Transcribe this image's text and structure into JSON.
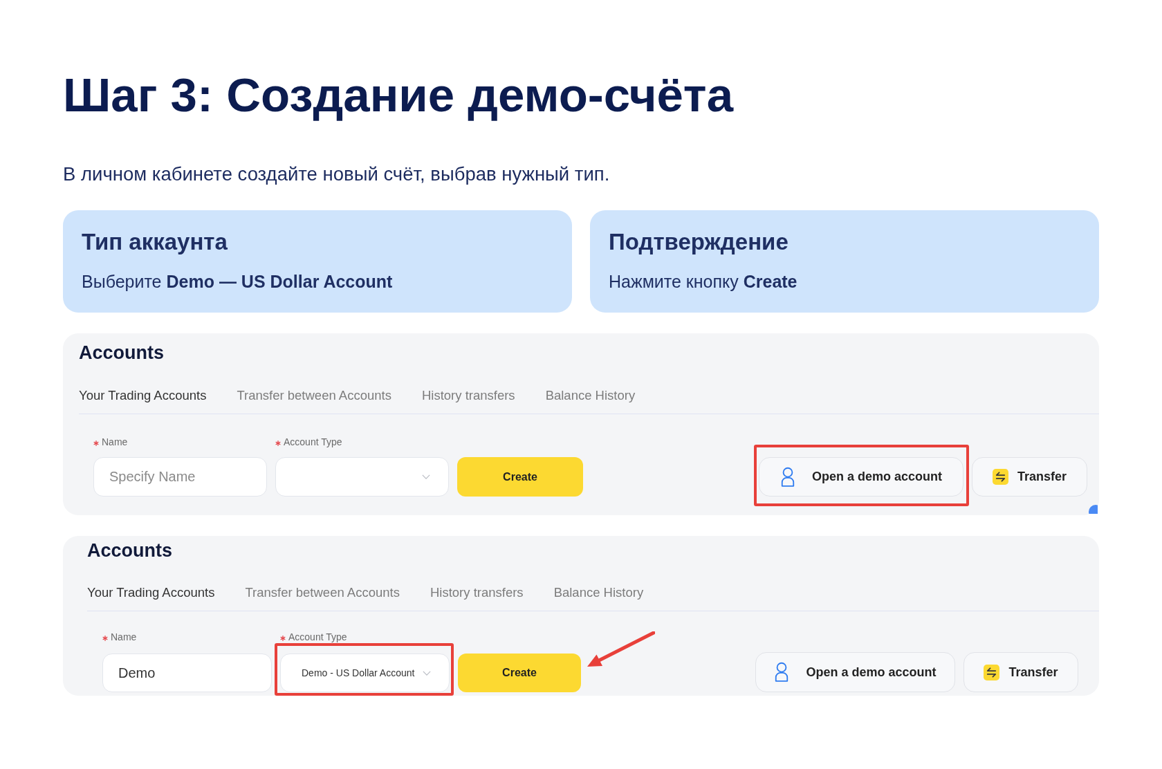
{
  "title": "Шаг 3: Создание демо-счёта",
  "subtitle": "В личном кабинете создайте новый счёт, выбрав нужный тип.",
  "cards": [
    {
      "title": "Тип аккаунта",
      "text": "Выберите **Demo — US Dollar Account**"
    },
    {
      "title": "Подтверждение",
      "text": "Нажмите кнопку **Create**"
    }
  ],
  "panels": [
    {
      "title": "Accounts",
      "tabs": [
        {
          "label": "Your Trading Accounts",
          "selected": true
        },
        {
          "label": "Transfer between Accounts",
          "selected": false
        },
        {
          "label": "History transfers",
          "selected": false
        },
        {
          "label": "Balance History",
          "selected": false
        }
      ],
      "fields": [
        {
          "kind": "text",
          "label": "Name",
          "required": true,
          "placeholder": "Specify Name",
          "highlighted": false
        },
        {
          "kind": "select",
          "label": "Account Type",
          "required": true,
          "highlighted": false
        }
      ],
      "create_button": {
        "label": "Create",
        "pointed_at": false
      },
      "actions": [
        {
          "kind": "demo",
          "label": "Open a demo account",
          "highlighted": true
        },
        {
          "kind": "transfer",
          "label": "Transfer",
          "highlighted": false
        }
      ]
    },
    {
      "title": "Accounts",
      "tabs": [
        {
          "label": "Your Trading Accounts",
          "selected": true
        },
        {
          "label": "Transfer between Accounts",
          "selected": false
        },
        {
          "label": "History transfers",
          "selected": false
        },
        {
          "label": "Balance History",
          "selected": false
        }
      ],
      "fields": [
        {
          "kind": "text",
          "label": "Name",
          "required": true,
          "value": "Demo",
          "highlighted": false
        },
        {
          "kind": "select",
          "label": "Account Type",
          "required": true,
          "value": "Demo - US Dollar Account",
          "highlighted": true
        }
      ],
      "create_button": {
        "label": "Create",
        "pointed_at": true
      },
      "actions": [
        {
          "kind": "demo",
          "label": "Open a demo account",
          "highlighted": false
        },
        {
          "kind": "transfer",
          "label": "Transfer",
          "highlighted": false
        }
      ]
    }
  ]
}
